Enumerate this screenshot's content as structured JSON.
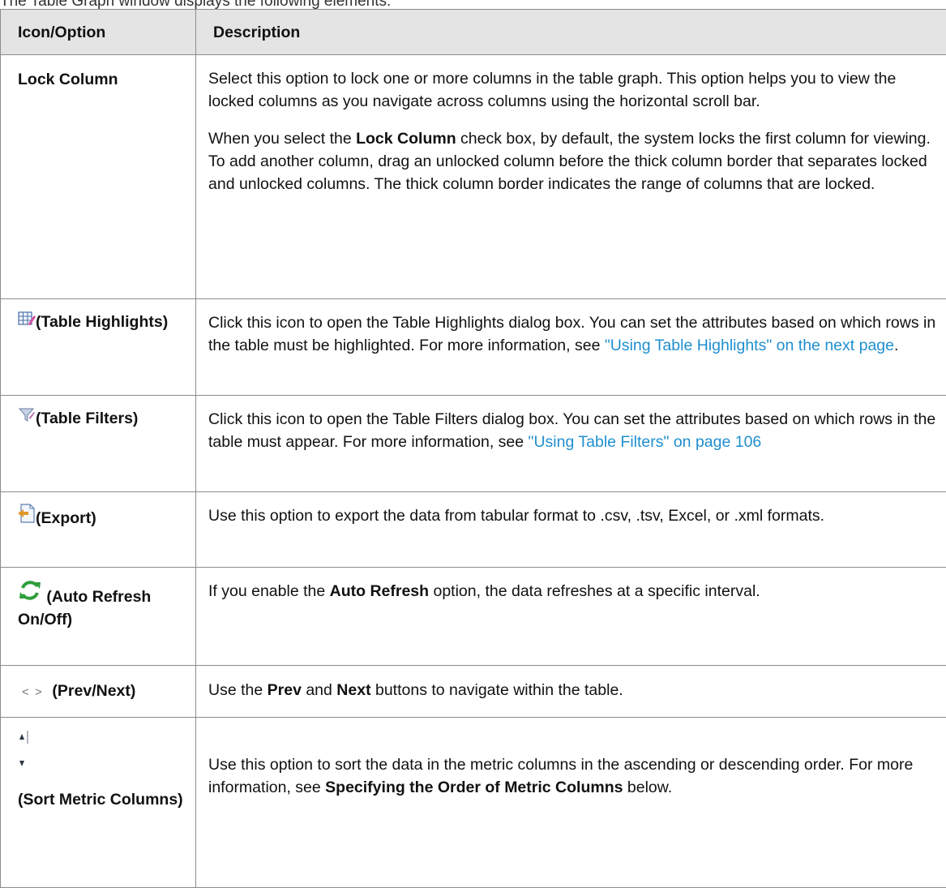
{
  "intro": "The Table Graph window displays the following elements:",
  "header": {
    "col1": "Icon/Option",
    "col2": "Description"
  },
  "rows": {
    "lock": {
      "option": "Lock Column",
      "p1": "Select this option to lock one or more columns in the table graph. This option helps you to view the locked columns as you navigate across columns using the horizontal scroll bar.",
      "p2_a": "When you select the ",
      "p2_b": "Lock Column",
      "p2_c": " check box, by default, the system locks the first column for viewing. To add another column, drag an unlocked column before the thick column border that separates locked and unlocked columns. The thick column border indicates the range of columns that are locked."
    },
    "highlights": {
      "option": "(Table Highlights)",
      "icon": "table-highlights-icon",
      "text_a": "Click this icon to open the Table Highlights dialog box. You can set the attributes based on which rows in the table must be highlighted. For more information, see ",
      "link": "\"Using Table Highlights\" on the next page",
      "text_b": "."
    },
    "filters": {
      "option": "(Table Filters)",
      "icon": "funnel-icon",
      "text_a": "Click this icon to open the Table Filters dialog box. You can set the attributes based on which rows in the table must appear. For more information, see ",
      "link": "\"Using Table Filters\" on page 106"
    },
    "export": {
      "option": "(Export)",
      "icon": "export-icon",
      "text": "Use this option to export the data from tabular format to .csv, .tsv, Excel, or .xml formats."
    },
    "refresh": {
      "option": "(Auto Refresh On/Off)",
      "icon": "refresh-icon",
      "text_a": "If you enable the ",
      "bold": "Auto Refresh",
      "text_b": " option, the data refreshes at a specific interval."
    },
    "prevnext": {
      "prev_glyph": "<",
      "next_glyph": ">",
      "option": "(Prev/Next)",
      "text_a": "Use the ",
      "bold1": "Prev",
      "text_b": " and ",
      "bold2": "Next",
      "text_c": " buttons to navigate within the table."
    },
    "sort": {
      "option": "(Sort Metric Columns)",
      "icons": [
        "sort-ascending-icon",
        "sort-descending-icon"
      ],
      "text_a": "Use this option to sort the data in the metric columns in the ascending or descending order. For more information, see ",
      "bold": "Specifying the Order of Metric Columns",
      "text_b": " below."
    }
  },
  "colors": {
    "header_bg": "#e4e4e4",
    "border": "#8c8c8c",
    "link": "#1f8fcf"
  }
}
